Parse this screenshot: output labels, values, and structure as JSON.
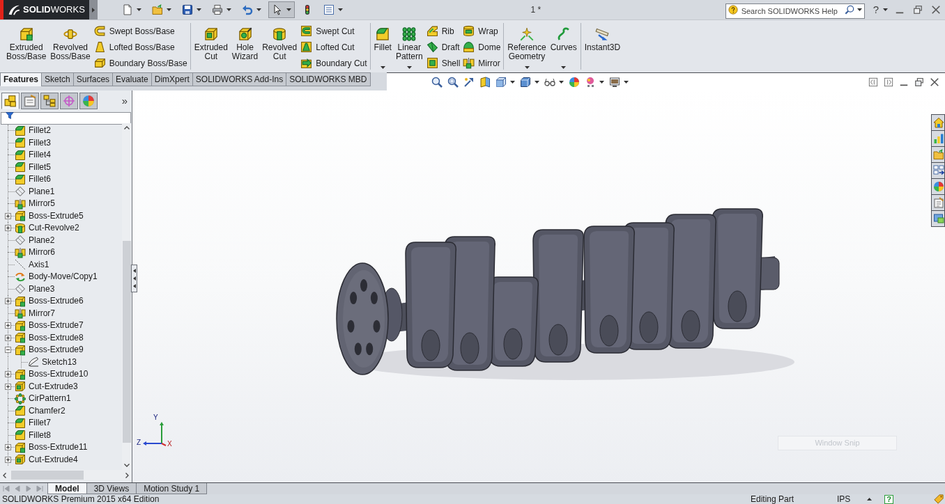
{
  "title_bar": {
    "logo": "**SOLID**WORKS",
    "document_title": "1 *",
    "search": {
      "placeholder": "Search SOLIDWORKS Help"
    },
    "help": "?"
  },
  "quick_access": [
    {
      "pressed": false,
      "menu": true
    },
    {
      "pressed": false,
      "menu": true
    },
    {
      "pressed": false,
      "menu": true
    },
    {
      "pressed": false,
      "menu": true
    },
    {
      "pressed": false,
      "menu": true
    },
    {
      "pressed": true,
      "menu": true
    },
    {
      "pressed": false,
      "menu": false
    },
    {
      "pressed": false,
      "menu": true
    }
  ],
  "command_manager": {
    "groups": [
      {
        "buttons": [
          {
            "kind": "large",
            "label": "Extruded Boss/Base",
            "menu": false
          },
          {
            "kind": "large",
            "label": "Revolved Boss/Base",
            "menu": false
          },
          {
            "kind": "stack",
            "buttons": [
              {
                "label": "Swept Boss/Base"
              },
              {
                "label": "Lofted Boss/Base"
              },
              {
                "label": "Boundary Boss/Base"
              }
            ]
          }
        ]
      },
      {
        "buttons": [
          {
            "kind": "large",
            "label": "Extruded Cut",
            "menu": false
          },
          {
            "kind": "large",
            "label": "Hole Wizard",
            "menu": false
          },
          {
            "kind": "large",
            "label": "Revolved Cut",
            "menu": false
          },
          {
            "kind": "stack",
            "buttons": [
              {
                "label": "Swept Cut"
              },
              {
                "label": "Lofted Cut"
              },
              {
                "label": "Boundary Cut"
              }
            ]
          }
        ]
      },
      {
        "buttons": [
          {
            "kind": "large",
            "label": "Fillet",
            "menu": true
          },
          {
            "kind": "large",
            "label": "Linear Pattern",
            "menu": true
          },
          {
            "kind": "stack",
            "buttons": [
              {
                "label": "Rib"
              },
              {
                "label": "Draft"
              },
              {
                "label": "Shell"
              }
            ]
          },
          {
            "kind": "stack",
            "buttons": [
              {
                "label": "Wrap"
              },
              {
                "label": "Dome"
              },
              {
                "label": "Mirror"
              }
            ]
          }
        ]
      },
      {
        "buttons": [
          {
            "kind": "large",
            "label": "Reference Geometry",
            "menu": true
          },
          {
            "kind": "large",
            "label": "Curves",
            "menu": true
          }
        ]
      },
      {
        "buttons": [
          {
            "kind": "large",
            "label": "Instant3D",
            "menu": false
          }
        ]
      }
    ]
  },
  "tabs": [
    {
      "label": "Features",
      "selected": true
    },
    {
      "label": "Sketch",
      "selected": false
    },
    {
      "label": "Surfaces",
      "selected": false
    },
    {
      "label": "Evaluate",
      "selected": false
    },
    {
      "label": "DimXpert",
      "selected": false
    },
    {
      "label": "SOLIDWORKS Add-Ins",
      "selected": false
    },
    {
      "label": "SOLIDWORKS MBD",
      "selected": false
    }
  ],
  "view_toolbar": [
    {
      "menu": false
    },
    {
      "menu": false
    },
    {
      "menu": false
    },
    {
      "menu": false
    },
    {
      "menu": true
    },
    {
      "menu": true
    },
    {
      "menu": true
    },
    {
      "menu": false
    },
    {
      "menu": true
    },
    {
      "menu": true
    }
  ],
  "feature_manager": {
    "panel_tabs": [
      {
        "selected": true
      },
      {
        "selected": false
      },
      {
        "selected": false
      },
      {
        "selected": false
      },
      {
        "selected": false
      }
    ],
    "more": "»",
    "items": [
      {
        "label": "Fillet2",
        "kind": "fillet"
      },
      {
        "label": "Fillet3",
        "kind": "fillet"
      },
      {
        "label": "Fillet4",
        "kind": "fillet"
      },
      {
        "label": "Fillet5",
        "kind": "fillet"
      },
      {
        "label": "Fillet6",
        "kind": "fillet"
      },
      {
        "label": "Plane1",
        "kind": "plane"
      },
      {
        "label": "Mirror5",
        "kind": "mirror"
      },
      {
        "label": "Boss-Extrude5",
        "kind": "boss-extrude",
        "expanded": false
      },
      {
        "label": "Cut-Revolve2",
        "kind": "cut-revolve",
        "expanded": false
      },
      {
        "label": "Plane2",
        "kind": "plane"
      },
      {
        "label": "Mirror6",
        "kind": "mirror"
      },
      {
        "label": "Axis1",
        "kind": "axis"
      },
      {
        "label": "Body-Move/Copy1",
        "kind": "move-copy"
      },
      {
        "label": "Plane3",
        "kind": "plane"
      },
      {
        "label": "Boss-Extrude6",
        "kind": "boss-extrude",
        "expanded": false
      },
      {
        "label": "Mirror7",
        "kind": "mirror"
      },
      {
        "label": "Boss-Extrude7",
        "kind": "boss-extrude",
        "expanded": false
      },
      {
        "label": "Boss-Extrude8",
        "kind": "boss-extrude",
        "expanded": false
      },
      {
        "label": "Boss-Extrude9",
        "kind": "boss-extrude",
        "expanded": true,
        "children": [
          {
            "label": "Sketch13",
            "kind": "sketch"
          }
        ]
      },
      {
        "label": "Boss-Extrude10",
        "kind": "boss-extrude",
        "expanded": false
      },
      {
        "label": "Cut-Extrude3",
        "kind": "cut-extrude",
        "expanded": false
      },
      {
        "label": "CirPattern1",
        "kind": "circular-pattern"
      },
      {
        "label": "Chamfer2",
        "kind": "chamfer"
      },
      {
        "label": "Fillet7",
        "kind": "fillet"
      },
      {
        "label": "Fillet8",
        "kind": "fillet"
      },
      {
        "label": "Boss-Extrude11",
        "kind": "boss-extrude",
        "expanded": false
      },
      {
        "label": "Cut-Extrude4",
        "kind": "cut-extrude",
        "expanded": false
      }
    ]
  },
  "viewport": {
    "triad": {
      "y_label": "Y",
      "z_label": "Z",
      "x_label": "X"
    },
    "snip_label": "Window Snip"
  },
  "bottom_tabs": [
    {
      "label": "Model",
      "selected": true
    },
    {
      "label": "3D Views",
      "selected": false
    },
    {
      "label": "Motion Study 1",
      "selected": false
    }
  ],
  "status_bar": {
    "product": "SOLIDWORKS Premium 2015 x64 Edition",
    "mode": "Editing Part",
    "units": "IPS",
    "help": "?"
  }
}
